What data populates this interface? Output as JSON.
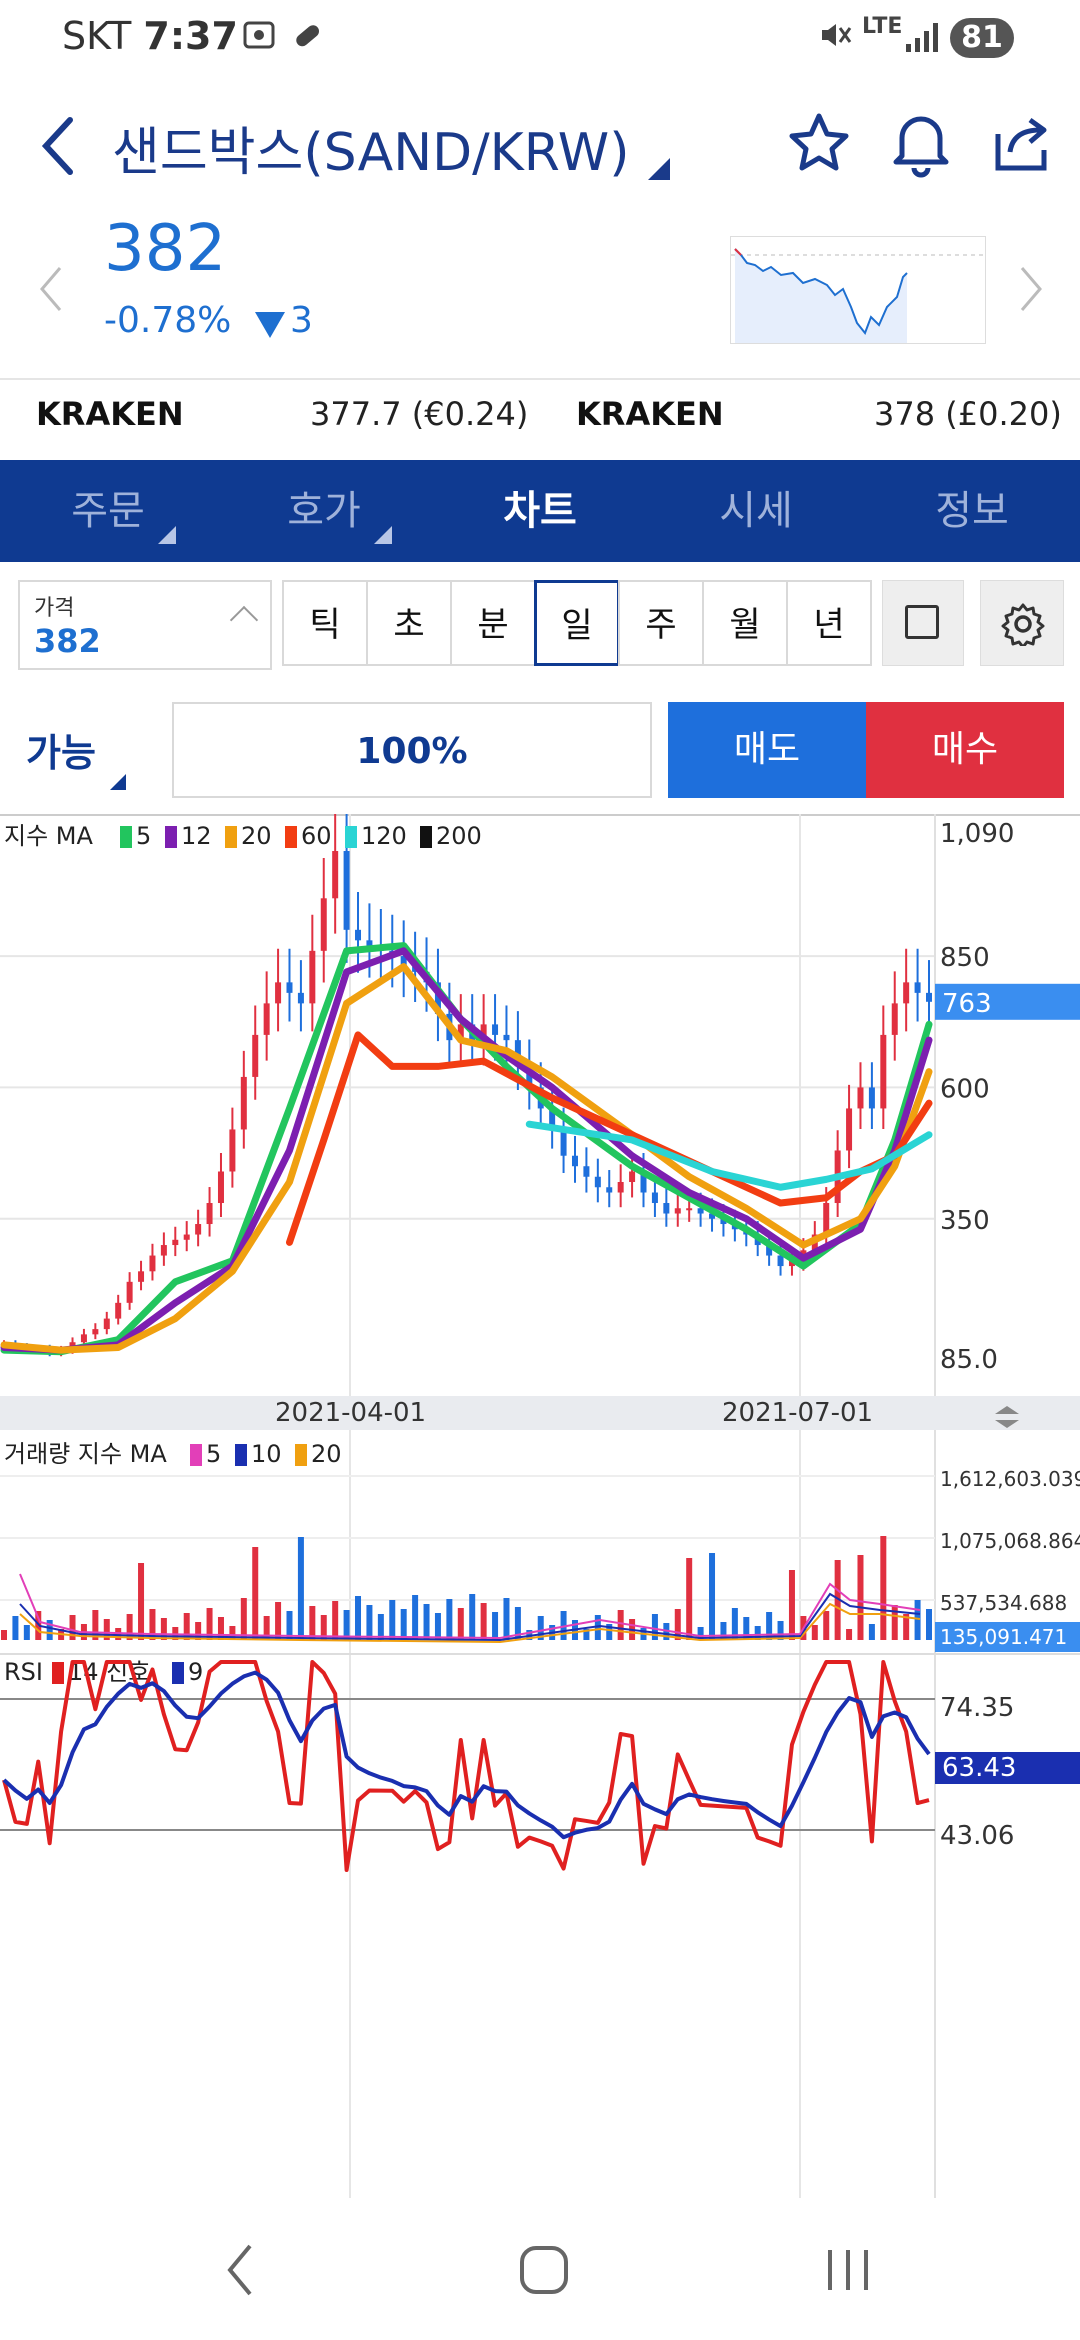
{
  "status_bar": {
    "carrier": "SKT",
    "time": "7:37",
    "network": "LTE",
    "battery": "81"
  },
  "header": {
    "title": "샌드박스(SAND/KRW)"
  },
  "ticker": {
    "price": "382",
    "change_pct": "-0.78%",
    "change_abs": "3"
  },
  "exchanges": [
    {
      "name": "KRAKEN",
      "value": "377.7 (€0.24)"
    },
    {
      "name": "KRAKEN",
      "value": "378 (£0.20)"
    }
  ],
  "tabs": [
    {
      "label": "주문",
      "has_corner": true
    },
    {
      "label": "호가",
      "has_corner": true
    },
    {
      "label": "차트",
      "active": true
    },
    {
      "label": "시세"
    },
    {
      "label": "정보"
    }
  ],
  "toolbar": {
    "price_label": "가격",
    "price_value": "382",
    "periods": [
      "틱",
      "초",
      "분",
      "일",
      "주",
      "월",
      "년"
    ],
    "active_period": "일"
  },
  "order": {
    "avail_label": "가능",
    "percent": "100%",
    "sell_label": "매도",
    "buy_label": "매수"
  },
  "chart_data": [
    {
      "type": "candlestick",
      "legend_title": "지수 MA",
      "legend": [
        {
          "name": "5",
          "color": "#22c55e"
        },
        {
          "name": "12",
          "color": "#7c1fb0"
        },
        {
          "name": "20",
          "color": "#f0a010"
        },
        {
          "name": "60",
          "color": "#f23d12"
        },
        {
          "name": "120",
          "color": "#2ad4d4"
        },
        {
          "name": "200",
          "color": "#111111"
        }
      ],
      "y_ticks": [
        "1,090",
        "850",
        "600",
        "350",
        "85.0"
      ],
      "current_label": "763",
      "x_ticks": [
        "2021-04-01",
        "2021-07-01"
      ],
      "close_series": [
        110,
        105,
        100,
        102,
        95,
        100,
        115,
        130,
        140,
        160,
        190,
        230,
        250,
        280,
        300,
        310,
        320,
        340,
        380,
        440,
        520,
        620,
        700,
        760,
        800,
        780,
        760,
        860,
        960,
        1050,
        900,
        880,
        870,
        860,
        850,
        830,
        820,
        800,
        740,
        690,
        720,
        690,
        720,
        700,
        690,
        640,
        600,
        560,
        520,
        470,
        450,
        430,
        410,
        400,
        420,
        440,
        400,
        380,
        360,
        370,
        370,
        360,
        350,
        340,
        330,
        320,
        300,
        280,
        260,
        270,
        290,
        320,
        380,
        480,
        560,
        600,
        560,
        700,
        760,
        800,
        780,
        763
      ],
      "ma_series": [
        {
          "name": "5",
          "color": "#22c55e",
          "points": [
            [
              0,
              100
            ],
            [
              5,
              97
            ],
            [
              10,
              120
            ],
            [
              15,
              230
            ],
            [
              20,
              270
            ],
            [
              25,
              560
            ],
            [
              30,
              860
            ],
            [
              35,
              870
            ],
            [
              40,
              730
            ],
            [
              44,
              640
            ],
            [
              48,
              560
            ],
            [
              55,
              450
            ],
            [
              60,
              390
            ],
            [
              65,
              330
            ],
            [
              70,
              260
            ],
            [
              75,
              340
            ],
            [
              78,
              500
            ],
            [
              81,
              720
            ]
          ]
        },
        {
          "name": "12",
          "color": "#7c1fb0",
          "points": [
            [
              0,
              105
            ],
            [
              5,
              100
            ],
            [
              10,
              110
            ],
            [
              15,
              190
            ],
            [
              20,
              260
            ],
            [
              25,
              480
            ],
            [
              30,
              820
            ],
            [
              35,
              860
            ],
            [
              40,
              730
            ],
            [
              44,
              660
            ],
            [
              48,
              600
            ],
            [
              55,
              470
            ],
            [
              60,
              400
            ],
            [
              65,
              350
            ],
            [
              70,
              275
            ],
            [
              75,
              330
            ],
            [
              78,
              480
            ],
            [
              81,
              690
            ]
          ]
        },
        {
          "name": "20",
          "color": "#f0a010",
          "points": [
            [
              0,
              110
            ],
            [
              5,
              100
            ],
            [
              10,
              105
            ],
            [
              15,
              160
            ],
            [
              20,
              250
            ],
            [
              25,
              420
            ],
            [
              30,
              760
            ],
            [
              35,
              830
            ],
            [
              40,
              690
            ],
            [
              44,
              670
            ],
            [
              48,
              620
            ],
            [
              55,
              510
            ],
            [
              60,
              430
            ],
            [
              65,
              370
            ],
            [
              70,
              300
            ],
            [
              75,
              350
            ],
            [
              78,
              450
            ],
            [
              81,
              630
            ]
          ]
        },
        {
          "name": "60",
          "color": "#f23d12",
          "points": [
            [
              25,
              305
            ],
            [
              28,
              500
            ],
            [
              31,
              700
            ],
            [
              34,
              640
            ],
            [
              38,
              640
            ],
            [
              42,
              650
            ],
            [
              48,
              580
            ],
            [
              55,
              510
            ],
            [
              62,
              440
            ],
            [
              68,
              380
            ],
            [
              72,
              390
            ],
            [
              75,
              440
            ],
            [
              78,
              470
            ],
            [
              81,
              570
            ]
          ]
        },
        {
          "name": "120",
          "color": "#2ad4d4",
          "points": [
            [
              46,
              530
            ],
            [
              55,
              500
            ],
            [
              62,
              440
            ],
            [
              68,
              410
            ],
            [
              72,
              425
            ],
            [
              76,
              445
            ],
            [
              81,
              510
            ]
          ]
        }
      ]
    },
    {
      "type": "bar",
      "legend_title": "거래량 지수 MA",
      "legend": [
        {
          "name": "5",
          "color": "#e23fb8"
        },
        {
          "name": "10",
          "color": "#1a2fb0"
        },
        {
          "name": "20",
          "color": "#f0a010"
        }
      ],
      "y_ticks": [
        "1,612,603.039",
        "1,075,068.864",
        "537,534.688"
      ],
      "current_label": "135,091.471"
    },
    {
      "type": "line",
      "legend_title": "RSI",
      "legend": [
        {
          "name": "14 신호",
          "color": "#e02020"
        },
        {
          "name": "9",
          "color": "#1a2fb0"
        }
      ],
      "y_ticks": [
        "74.35",
        "43.06"
      ],
      "current_label": "63.43"
    }
  ],
  "nav": {
    "back": "back",
    "home": "home",
    "recents": "recents"
  }
}
